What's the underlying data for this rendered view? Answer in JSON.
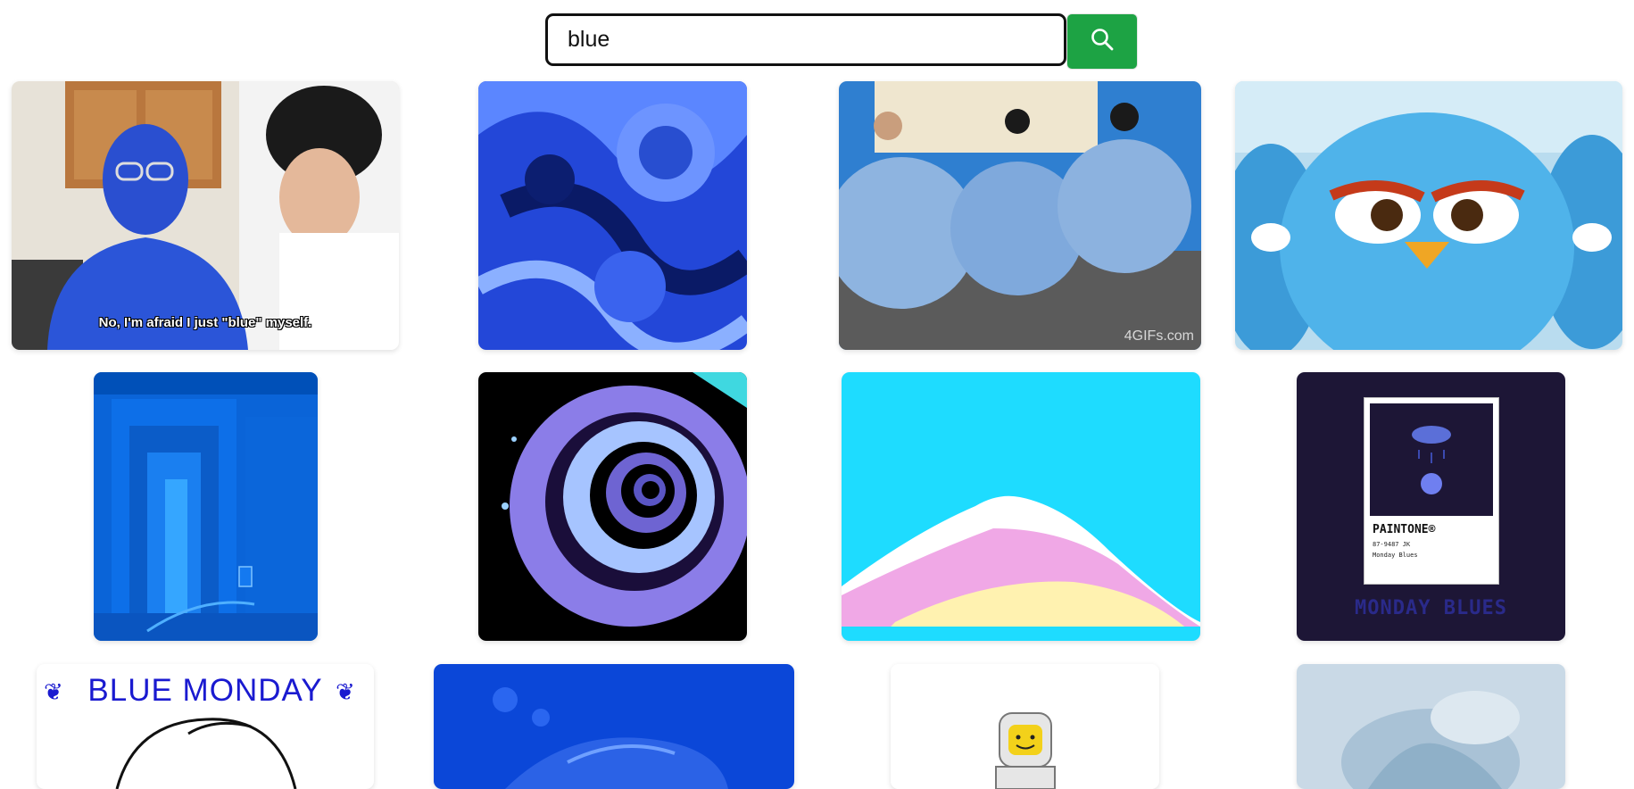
{
  "search": {
    "value": "blue",
    "button_icon": "search-icon"
  },
  "colors": {
    "search_button": "#1da344",
    "background": "#ffffff"
  },
  "results": [
    {
      "name": "gif-blue-myself",
      "caption": "No, I'm afraid I just \"blue\" myself."
    },
    {
      "name": "gif-blue-swirl"
    },
    {
      "name": "gif-blue-balloon-suits",
      "watermark": "4GIFs.com"
    },
    {
      "name": "gif-blue-angry-bird"
    },
    {
      "name": "gif-blue-hallway"
    },
    {
      "name": "gif-blue-spiral-tunnel"
    },
    {
      "name": "gif-pastel-mountain"
    },
    {
      "name": "gif-monday-blues",
      "paintone_title": "PAINTONE®",
      "paintone_code": "87-9487 JK",
      "paintone_name": "Monday Blues",
      "banner": "MONDAY BLUES"
    },
    {
      "name": "gif-blue-monday",
      "title": "BLUE MONDAY"
    },
    {
      "name": "gif-blue-sleeping-figure"
    },
    {
      "name": "gif-lego-astronaut"
    },
    {
      "name": "gif-pale-blue-figure"
    }
  ]
}
